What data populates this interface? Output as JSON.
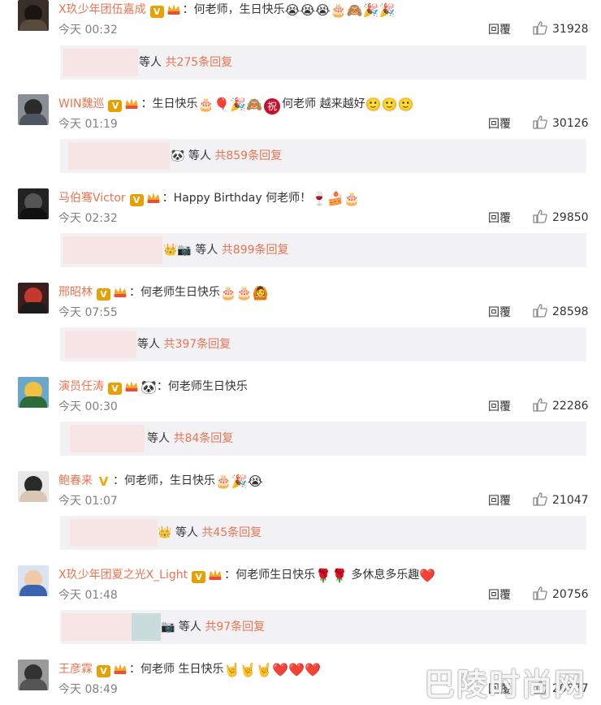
{
  "comments": [
    {
      "name": "X玖少年团伍嘉成",
      "text": "：何老师，生日快乐",
      "emojis": "😭😭😭🎂🙈🎉🎉",
      "time": "今天 00:32",
      "reply": "回覆",
      "likes": "31928",
      "reply_prefix": "",
      "reply_suffix": "等人",
      "reply_count": "共275条回复",
      "badge": "V"
    },
    {
      "name": "WIN魏巡",
      "text": "：生日快乐",
      "emojis": "🎂🎈🎉🙈",
      "text2": "何老师  越来越好",
      "emojis2": "🙂🙂🙂",
      "time": "今天 01:19",
      "reply": "回覆",
      "likes": "30126",
      "reply_prefix": "🐼",
      "reply_suffix": "等人",
      "reply_count": "共859条回复",
      "badge": "V"
    },
    {
      "name": "马伯骞Victor",
      "text": "：Happy Birthday 何老师！",
      "emojis": "🍷🍰🎂",
      "time": "今天 02:32",
      "reply": "回覆",
      "likes": "29850",
      "reply_prefix": "👑📷",
      "reply_suffix": "等人",
      "reply_count": "共899条回复",
      "badge": "V"
    },
    {
      "name": "邢昭林",
      "text": "：何老师生日快乐",
      "emojis": "🎂🎂🙆",
      "time": "今天 07:55",
      "reply": "回覆",
      "likes": "28598",
      "reply_prefix": "",
      "reply_suffix": "等人",
      "reply_count": "共397条回复",
      "badge": "V"
    },
    {
      "name": "演员任涛",
      "text": "：何老师生日快乐",
      "emojis": "🐼",
      "time": "今天 00:30",
      "reply": "回覆",
      "likes": "22286",
      "reply_prefix": "",
      "reply_suffix": "等人",
      "reply_count": "共84条回复",
      "badge": "V"
    },
    {
      "name": "鲍春来",
      "text": "：何老师，生日快乐",
      "emojis": "🎂🎉😭",
      "time": "今天 01:07",
      "reply": "回覆",
      "likes": "21047",
      "reply_prefix": "👑",
      "reply_suffix": "等人",
      "reply_count": "共45条回复",
      "badge": "V"
    },
    {
      "name": "X玖少年团夏之光X_Light",
      "text": "：何老师生日快乐",
      "emojis": "🌹🌹",
      "text2": "多休息多乐趣",
      "emojis2": "❤️",
      "time": "今天 01:48",
      "reply": "回覆",
      "likes": "20756",
      "reply_prefix": "📷",
      "reply_suffix": "等人",
      "reply_count": "共97条回复",
      "badge": "V"
    },
    {
      "name": "王彦霖",
      "text": "：何老师 生日快乐",
      "emojis": "🤘🤘🤘❤️❤️❤️",
      "time": "今天 08:49",
      "reply": "回覆",
      "likes": "20877",
      "reply_prefix": "",
      "reply_suffix": "",
      "reply_count": "",
      "badge": "V"
    }
  ],
  "watermark": "巴陵时尚网",
  "colors": {
    "name": "#eb7350",
    "badge": "#e6a000",
    "reply_bg": "#f2f2f5",
    "time": "#808080"
  }
}
